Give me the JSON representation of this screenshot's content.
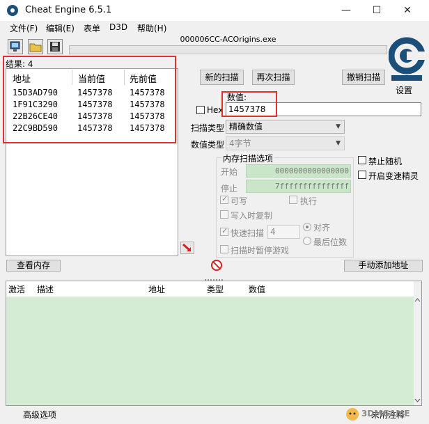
{
  "window": {
    "title": "Cheat Engine 6.5.1",
    "minimize": "—",
    "maximize": "☐",
    "close": "✕",
    "icon": "cheat-engine-icon"
  },
  "menu": [
    "文件(F)",
    "编辑(E)",
    "表单",
    "D3D",
    "帮助(H)"
  ],
  "toolbar": {
    "process_name": "000006CC-ACOrigins.exe",
    "buttons": [
      "open-process-icon",
      "open-file-icon",
      "save-icon"
    ]
  },
  "settings": {
    "label": "设置"
  },
  "results": {
    "label": "结果: 4",
    "columns": [
      "地址",
      "当前值",
      "先前值"
    ],
    "rows": [
      {
        "address": "15D3AD790",
        "current": "1457378",
        "previous": "1457378"
      },
      {
        "address": "1F91C3290",
        "current": "1457378",
        "previous": "1457378"
      },
      {
        "address": "22B26CE40",
        "current": "1457378",
        "previous": "1457378"
      },
      {
        "address": "22C9BD590",
        "current": "1457378",
        "previous": "1457378"
      }
    ]
  },
  "scan": {
    "new_scan": "新的扫描",
    "next_scan": "再次扫描",
    "undo_scan": "撤销扫描",
    "value_label": "数值:",
    "value": "1457378",
    "hex_label": "Hex",
    "scan_type_label": "扫描类型",
    "scan_type_value": "精确数值",
    "value_type_label": "数值类型",
    "value_type_value": "4字节"
  },
  "memory_options": {
    "title": "内存扫描选项",
    "start_label": "开始",
    "start_value": "0000000000000000",
    "stop_label": "停止",
    "stop_value": "7fffffffffffffff",
    "writable": "可写",
    "executable": "执行",
    "copy_on_write": "写入时复制",
    "fast_scan": "快速扫描",
    "fast_scan_value": "4",
    "align": "对齐",
    "last_digits": "最后位数",
    "pause_game": "扫描时暂停游戏"
  },
  "side_options": {
    "disable_random": "禁止随机",
    "speedhack": "开启变速精灵"
  },
  "buttons": {
    "view_memory": "查看内存",
    "add_address_manually": "手动添加地址"
  },
  "address_list": {
    "columns": [
      "激活",
      "描述",
      "地址",
      "类型",
      "数值"
    ]
  },
  "status": {
    "advanced_options": "高级选项",
    "table_extras": "未附注释"
  },
  "watermark": "3DMGAME",
  "colors": {
    "highlight": "#e03131",
    "list_green": "#d4ecd4",
    "logo_blue": "#1b4f7a"
  }
}
